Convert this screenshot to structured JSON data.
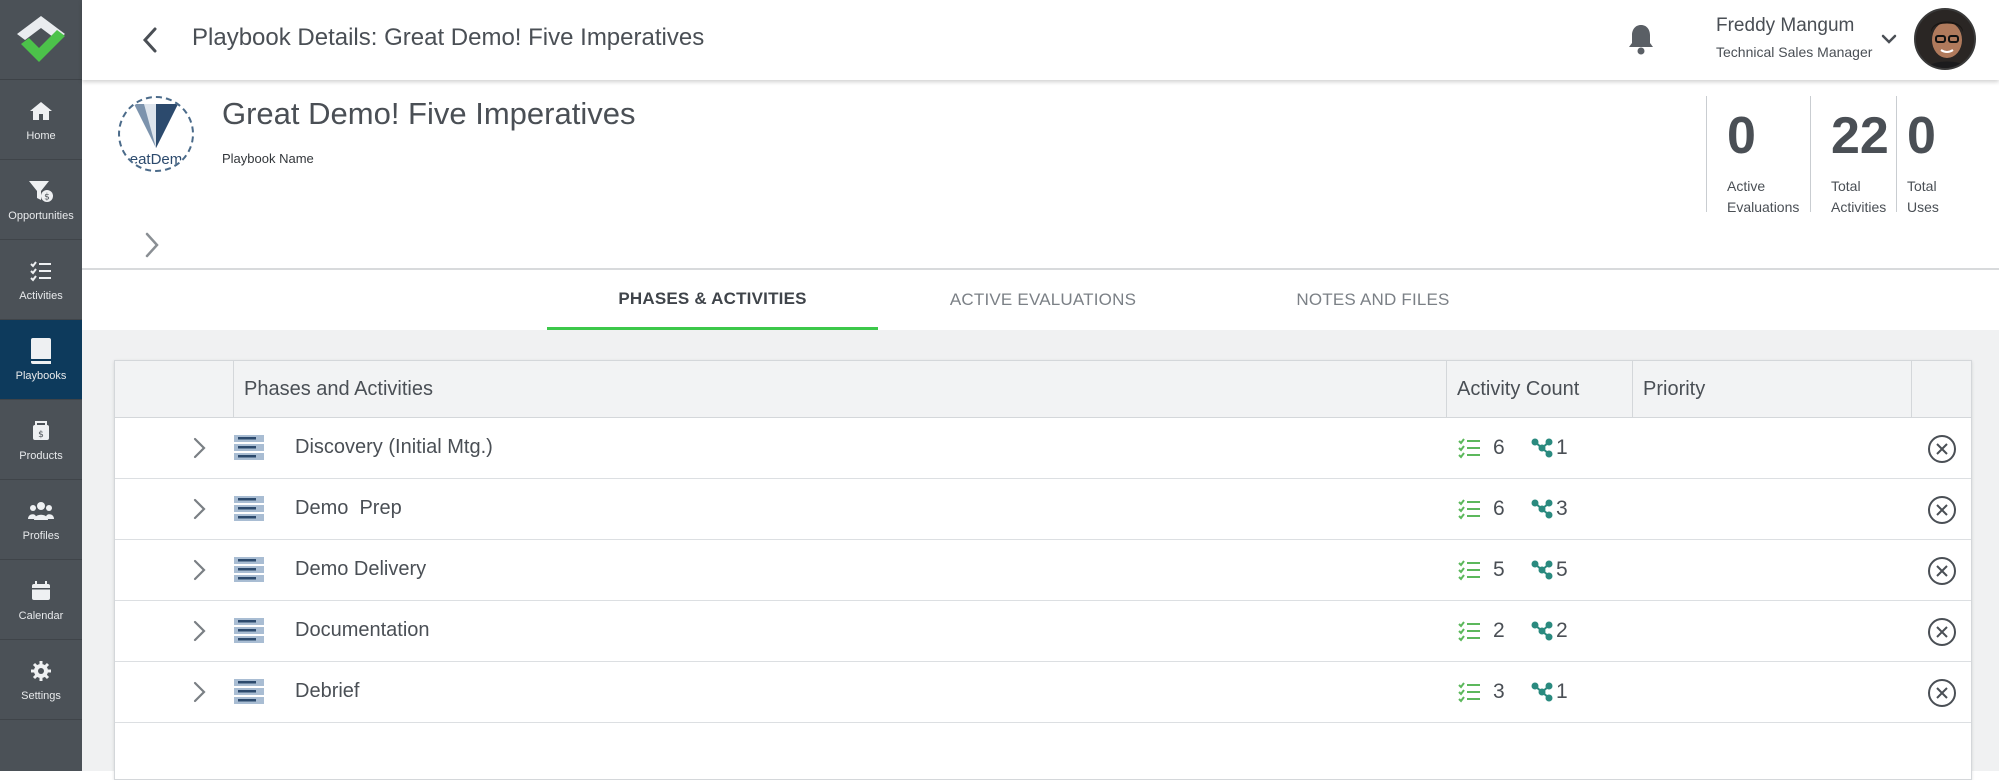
{
  "sidebar": {
    "items": [
      {
        "label": "Home",
        "icon": "home-icon"
      },
      {
        "label": "Opportunities",
        "icon": "funnel-dollar-icon"
      },
      {
        "label": "Activities",
        "icon": "checklist-icon"
      },
      {
        "label": "Playbooks",
        "icon": "book-icon",
        "active": true
      },
      {
        "label": "Products",
        "icon": "product-box-icon"
      },
      {
        "label": "Profiles",
        "icon": "people-icon"
      },
      {
        "label": "Calendar",
        "icon": "calendar-icon"
      },
      {
        "label": "Settings",
        "icon": "gear-icon"
      }
    ]
  },
  "header": {
    "title": "Playbook Details: Great Demo! Five Imperatives",
    "user": {
      "name": "Freddy Mangum",
      "role": "Technical Sales Manager"
    }
  },
  "playbook": {
    "name": "Great Demo! Five Imperatives",
    "name_label": "Playbook Name",
    "logo_text": "eatDem",
    "stats": [
      {
        "value": "0",
        "label_line1": "Active",
        "label_line2": "Evaluations"
      },
      {
        "value": "22",
        "label_line1": "Total",
        "label_line2": "Activities"
      },
      {
        "value": "0",
        "label_line1": "Total",
        "label_line2": "Uses"
      }
    ]
  },
  "tabs": [
    {
      "label": "PHASES & ACTIVITIES",
      "active": true
    },
    {
      "label": "ACTIVE EVALUATIONS",
      "active": false
    },
    {
      "label": "NOTES AND FILES",
      "active": false
    }
  ],
  "table": {
    "columns": [
      "Phases and Activities",
      "Activity Count",
      "Priority"
    ],
    "rows": [
      {
        "name": "Discovery (Initial Mtg.)",
        "activities": "6",
        "flows": "1"
      },
      {
        "name": "Demo  Prep",
        "activities": "6",
        "flows": "3"
      },
      {
        "name": "Demo Delivery",
        "activities": "5",
        "flows": "5"
      },
      {
        "name": "Documentation",
        "activities": "2",
        "flows": "2"
      },
      {
        "name": "Debrief",
        "activities": "3",
        "flows": "1"
      }
    ]
  },
  "colors": {
    "sidebar_bg": "#4b5157",
    "sidebar_active": "#0d3a5c",
    "tab_accent": "#3cc84a",
    "logo_green": "#4cc24a",
    "checklist_green": "#5cb85c",
    "flow_teal": "#2a8a7f"
  }
}
